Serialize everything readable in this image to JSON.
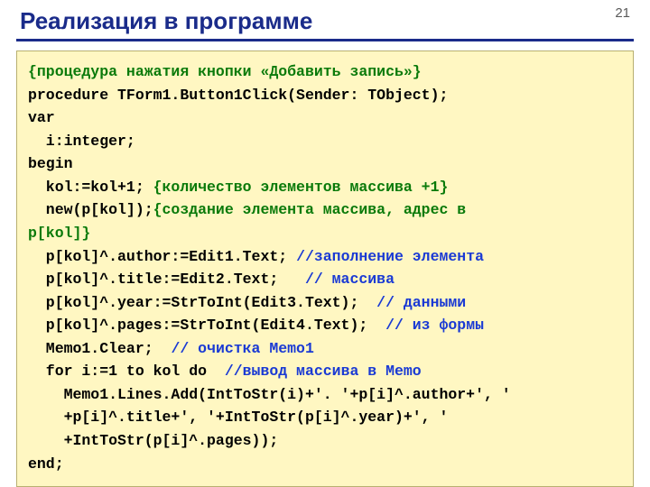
{
  "page_number": "21",
  "title": "Реализация в программе",
  "code": {
    "l1_comment": "{процедура нажатия кнопки «Добавить запись»}",
    "l2": "procedure TForm1.Button1Click(Sender: TObject);",
    "l3": "var",
    "l4": "  i:integer;",
    "l5": "begin",
    "l6a": "  kol:=kol+1; ",
    "l6b": "{количество элементов массива +1}",
    "l7a": "  new(p[kol]);",
    "l7b": "{создание элемента массива, адрес в",
    "l7c": "p[kol]}",
    "l8a": "  p[kol]^.author:=Edit1.Text; ",
    "l8b": "//заполнение элемента",
    "l9a": "  p[kol]^.title:=Edit2.Text;   ",
    "l9b": "// массива",
    "l10a": "  p[kol]^.year:=StrToInt(Edit3.Text);  ",
    "l10b": "// данными",
    "l11a": "  p[kol]^.pages:=StrToInt(Edit4.Text);  ",
    "l11b": "// из формы",
    "l12a": "  Memo1.Clear;  ",
    "l12b": "// очистка Memo1",
    "l13a": "  for i:=1 to kol do  ",
    "l13b": "//вывод массива в Memo",
    "l14": "    Memo1.Lines.Add(IntToStr(i)+'. '+p[i]^.author+', '",
    "l15": "    +p[i]^.title+', '+IntToStr(p[i]^.year)+', '",
    "l16": "    +IntToStr(p[i]^.pages));",
    "l17": "end;"
  }
}
